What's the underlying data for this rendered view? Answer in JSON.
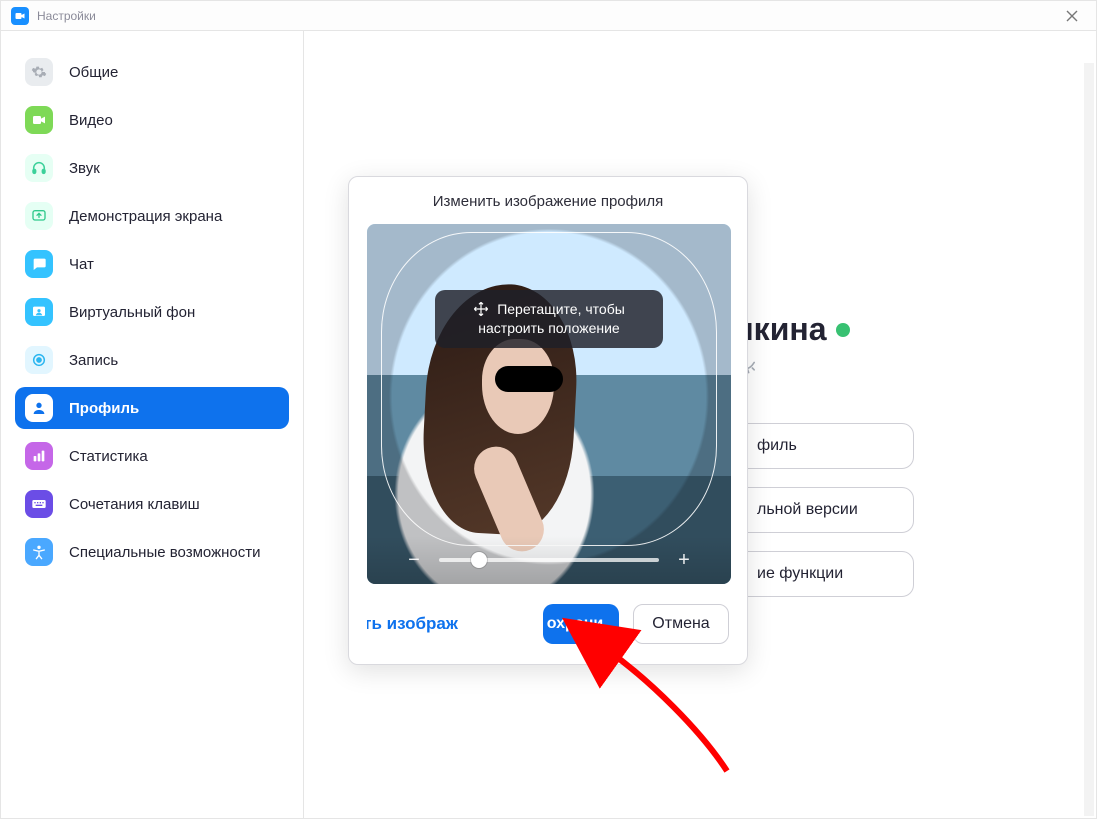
{
  "window": {
    "title": "Настройки"
  },
  "sidebar": {
    "items": [
      {
        "label": "Общие"
      },
      {
        "label": "Видео"
      },
      {
        "label": "Звук"
      },
      {
        "label": "Демонстрация экрана"
      },
      {
        "label": "Чат"
      },
      {
        "label": "Виртуальный фон"
      },
      {
        "label": "Запись"
      },
      {
        "label": "Профиль"
      },
      {
        "label": "Статистика"
      },
      {
        "label": "Сочетания клавиш"
      },
      {
        "label": "Специальные возможности"
      }
    ],
    "active_index": 7
  },
  "profile": {
    "name_visible_fragment": "икина",
    "status": "online",
    "buttons": [
      {
        "visible_fragment": "филь"
      },
      {
        "visible_fragment": "льной версии"
      },
      {
        "visible_fragment": "ие функции"
      }
    ]
  },
  "modal": {
    "title": "Изменить изображение профиля",
    "drag_tip_line1": "Перетащите, чтобы",
    "drag_tip_line2": "настроить положение",
    "zoom": {
      "min_symbol": "−",
      "plus_symbol": "+"
    },
    "change_image_label_fragment": "енить изображ",
    "save_label_fragment": "охрани",
    "cancel_label": "Отмена"
  },
  "annotation": {
    "type": "arrow",
    "color": "#ff0000",
    "points_to": "save-button"
  }
}
